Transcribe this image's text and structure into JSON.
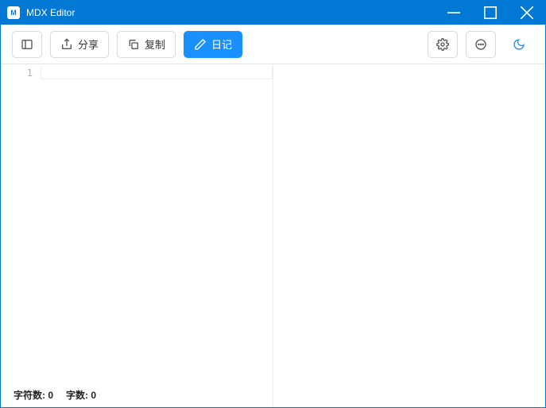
{
  "titlebar": {
    "app_icon_text": "M",
    "title": "MDX Editor"
  },
  "toolbar": {
    "share_label": "分享",
    "copy_label": "复制",
    "diary_label": "日记"
  },
  "editor": {
    "line_number": "1",
    "content": ""
  },
  "statusbar": {
    "chars_label": "字符数:",
    "chars_value": "0",
    "words_label": "字数:",
    "words_value": "0"
  }
}
